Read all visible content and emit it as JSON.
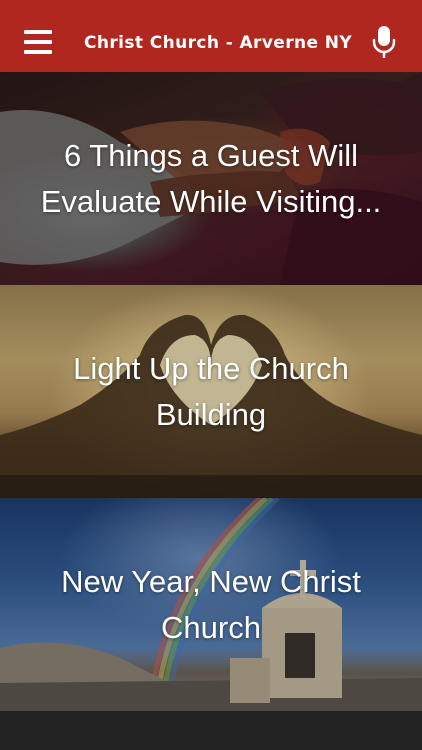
{
  "header": {
    "title": "Christ Church - Arverne NY",
    "menu_icon": "hamburger-menu-icon",
    "mic_icon": "microphone-icon"
  },
  "colors": {
    "header_bg": "#b02720",
    "text": "#ffffff"
  },
  "posts": [
    {
      "title": "6 Things a Guest Will Evaluate While Visiting...",
      "image": "joined-hands-photo"
    },
    {
      "title": "Light Up the Church Building",
      "image": "heart-hands-sunset-photo"
    },
    {
      "title": "New Year, New Christ Church",
      "image": "rainbow-church-bell-photo"
    }
  ]
}
